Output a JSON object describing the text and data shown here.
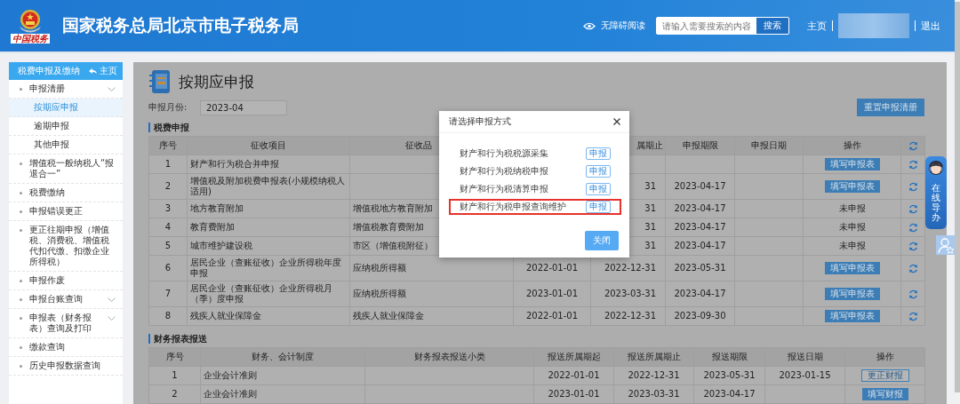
{
  "header": {
    "site_title": "国家税务总局北京市电子税务局",
    "logo_caption": "中国税务",
    "accessibility_link": "无障碍阅读",
    "search": {
      "placeholder": "请输入需要搜索的内容",
      "button": "搜索"
    },
    "home_link": "主页",
    "logout_link": "退出"
  },
  "sidebar": {
    "title": "税费申报及缴纳",
    "home_link": "主页",
    "items": [
      {
        "label": "申报清册",
        "selected": false,
        "expandable": true,
        "children": [
          {
            "label": "按期应申报",
            "selected": true
          },
          {
            "label": "逾期申报",
            "selected": false
          },
          {
            "label": "其他申报",
            "selected": false
          }
        ]
      },
      {
        "label": "增值税一般纳税人“报退合一”",
        "selected": false,
        "expandable": false
      },
      {
        "label": "税费缴纳",
        "selected": false,
        "expandable": false
      },
      {
        "label": "申报错误更正",
        "selected": false,
        "expandable": false
      },
      {
        "label": "更正往期申报（增值税、消费税、增值税代扣代缴、扣缴企业所得税）",
        "selected": false,
        "expandable": false
      },
      {
        "label": "申报作废",
        "selected": false,
        "expandable": false
      },
      {
        "label": "申报台账查询",
        "selected": false,
        "expandable": true
      },
      {
        "label": "申报表（财务报表）查询及打印",
        "selected": false,
        "expandable": true
      },
      {
        "label": "缴款查询",
        "selected": false,
        "expandable": false
      },
      {
        "label": "历史申报数据查询",
        "selected": false,
        "expandable": false
      }
    ]
  },
  "page": {
    "title": "按期应申报",
    "month_label": "申报月份:",
    "month_value": "2023-04",
    "reset_button": "重置申报清册"
  },
  "tax_section": {
    "title": "税费申报",
    "columns": [
      "序号",
      "征收项目",
      "征收品",
      "",
      "属期止",
      "申报期限",
      "申报日期",
      "操作"
    ],
    "rows": [
      {
        "cells": [
          "1",
          "财产和行为税合并申报",
          "",
          "",
          "",
          "",
          ""
        ],
        "action": {
          "kind": "button",
          "text": "填写申报表"
        }
      },
      {
        "cells": [
          "2",
          "增值税及附加税费申报表(小规模纳税人适用)",
          "",
          "",
          "31",
          "2023-04-17",
          ""
        ],
        "action": {
          "kind": "button",
          "text": "填写申报表"
        }
      },
      {
        "cells": [
          "3",
          "地方教育附加",
          "增值税地方教育附加",
          "",
          "31",
          "2023-04-17",
          ""
        ],
        "action": {
          "kind": "status",
          "text": "未申报"
        }
      },
      {
        "cells": [
          "4",
          "教育费附加",
          "增值税教育费附加",
          "",
          "31",
          "2023-04-17",
          ""
        ],
        "action": {
          "kind": "status",
          "text": "未申报"
        }
      },
      {
        "cells": [
          "5",
          "城市维护建设税",
          "市区（增值税附征）",
          "",
          "31",
          "2023-04-17",
          ""
        ],
        "action": {
          "kind": "status",
          "text": "未申报"
        }
      },
      {
        "cells": [
          "6",
          "居民企业（查账征收）企业所得税年度申报",
          "应纳税所得额",
          "2022-01-01",
          "2022-12-31",
          "2023-05-31",
          ""
        ],
        "action": {
          "kind": "button",
          "text": "填写申报表"
        }
      },
      {
        "cells": [
          "7",
          "居民企业（查账征收）企业所得税月（季）度申报",
          "应纳税所得额",
          "2023-01-01",
          "2023-03-31",
          "2023-04-17",
          ""
        ],
        "action": {
          "kind": "button",
          "text": "填写申报表"
        }
      },
      {
        "cells": [
          "8",
          "残疾人就业保障金",
          "残疾人就业保障金",
          "2022-01-01",
          "2022-12-31",
          "2023-09-30",
          ""
        ],
        "action": {
          "kind": "button",
          "text": "填写申报表"
        }
      }
    ]
  },
  "finance_section": {
    "title": "财务报表报送",
    "columns": [
      "序号",
      "财务、会计制度",
      "财务报表报送小类",
      "报送所属期起",
      "报送所属期止",
      "报送期限",
      "报送日期",
      "操作"
    ],
    "rows": [
      {
        "cells": [
          "1",
          "企业会计准则",
          "",
          "2022-01-01",
          "2022-12-31",
          "2023-05-31",
          "2023-01-15"
        ],
        "action": {
          "kind": "outline",
          "text": "更正财报"
        }
      },
      {
        "cells": [
          "2",
          "企业会计准则",
          "",
          "2023-01-01",
          "2023-03-31",
          "2023-04-17",
          ""
        ],
        "action": {
          "kind": "filled",
          "text": "填写财报"
        }
      }
    ]
  },
  "dialog": {
    "title": "请选择申报方式",
    "options": [
      {
        "label": "财产和行为税税源采集",
        "button": "申报",
        "highlighted": false
      },
      {
        "label": "财产和行为税纳税申报",
        "button": "申报",
        "highlighted": false
      },
      {
        "label": "财产和行为税清算申报",
        "button": "申报",
        "highlighted": false
      },
      {
        "label": "财产和行为税申报查询维护",
        "button": "申报",
        "highlighted": true
      }
    ],
    "close_button": "关闭"
  },
  "assistant": {
    "label": "在线导办"
  }
}
